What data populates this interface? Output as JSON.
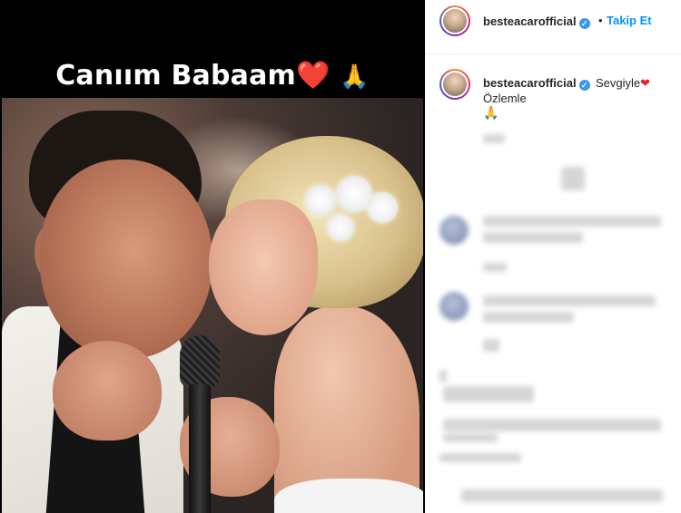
{
  "story": {
    "caption_text": "Canıım Babaam",
    "caption_heart": "❤️",
    "caption_pray": "🙏"
  },
  "header": {
    "username": "besteacarofficial",
    "verified_icon": "✓",
    "separator": "•",
    "follow_label": "Takip Et"
  },
  "caption_comment": {
    "username": "besteacarofficial",
    "verified_icon": "✓",
    "text": "Sevgiyle",
    "heart": "❤",
    "line2": "Özlemle",
    "line3": "🙏"
  },
  "colors": {
    "link_blue": "#0095f6",
    "verified_blue": "#3897f0",
    "heart_red": "#e0262d"
  }
}
